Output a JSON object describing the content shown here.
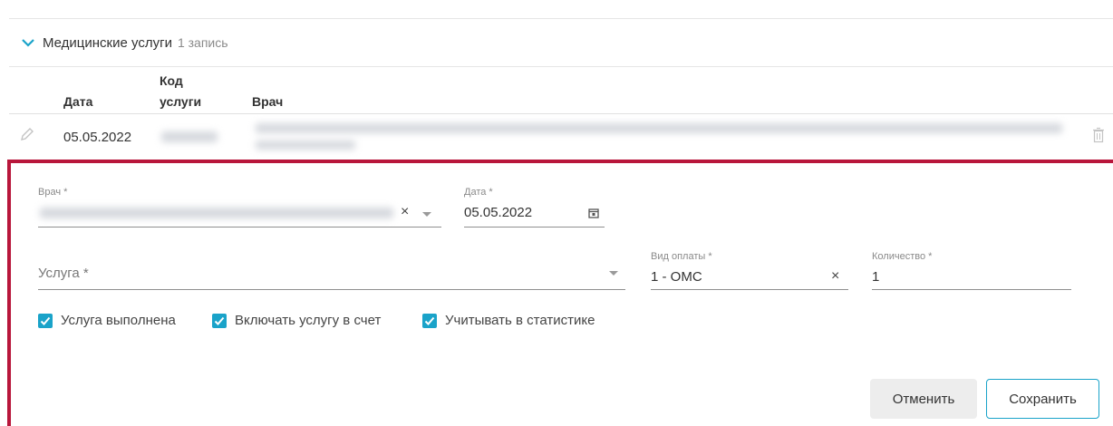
{
  "section": {
    "title": "Медицинские услуги",
    "count": "1 запись"
  },
  "table": {
    "headers": {
      "date": "Дата",
      "code_line1": "Код",
      "code_line2": "услуги",
      "doctor": "Врач"
    },
    "rows": [
      {
        "date": "05.05.2022"
      }
    ]
  },
  "form": {
    "doctor_label": "Врач *",
    "date_label": "Дата *",
    "date_value": "05.05.2022",
    "service_placeholder": "Услуга *",
    "payment_label": "Вид оплаты *",
    "payment_value": "1 - ОМС",
    "quantity_label": "Количество *",
    "quantity_value": "1",
    "clear_symbol": "×",
    "checkboxes": [
      {
        "label": "Услуга выполнена",
        "checked": true
      },
      {
        "label": "Включать услугу в счет",
        "checked": true
      },
      {
        "label": "Учитывать в статистике",
        "checked": true
      }
    ],
    "cancel_label": "Отменить",
    "save_label": "Сохранить"
  },
  "colors": {
    "accent": "#1aa3c9",
    "edit_border": "#b8163b",
    "cancel_bg": "#ededed"
  },
  "icons": [
    "chevron-down-icon",
    "pencil-icon",
    "trash-icon",
    "calendar-icon",
    "check-icon",
    "close-icon",
    "dropdown-caret-icon"
  ]
}
